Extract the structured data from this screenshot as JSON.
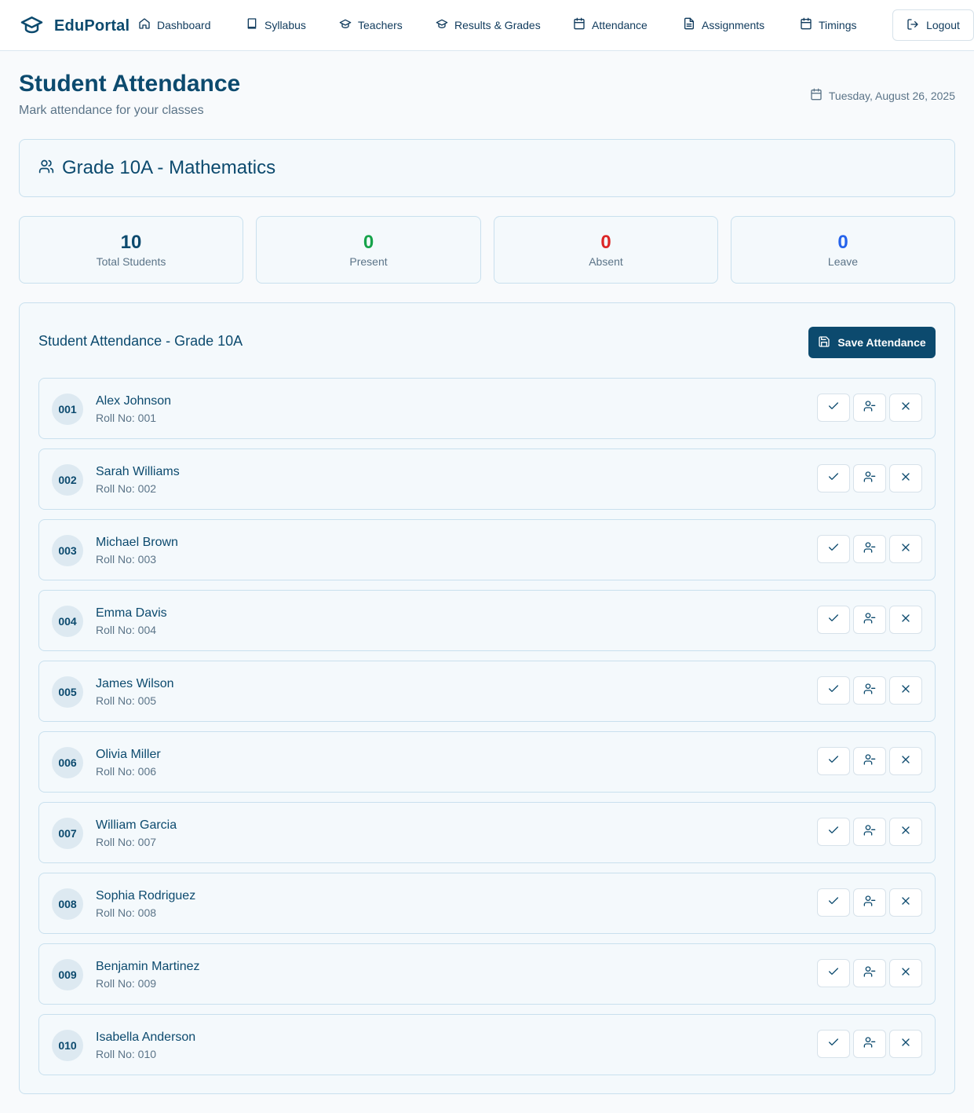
{
  "app": {
    "name": "EduPortal"
  },
  "nav": {
    "items": [
      {
        "label": "Dashboard",
        "icon": "home-icon"
      },
      {
        "label": "Syllabus",
        "icon": "book-icon"
      },
      {
        "label": "Teachers",
        "icon": "graduation-cap-icon"
      },
      {
        "label": "Results & Grades",
        "icon": "graduation-cap-icon"
      },
      {
        "label": "Attendance",
        "icon": "calendar-icon"
      },
      {
        "label": "Assignments",
        "icon": "document-icon"
      },
      {
        "label": "Timings",
        "icon": "calendar-icon"
      }
    ],
    "logout_label": "Logout"
  },
  "header": {
    "title": "Student Attendance",
    "subtitle": "Mark attendance for your classes",
    "date": "Tuesday, August 26, 2025"
  },
  "class_card": {
    "title": "Grade 10A - Mathematics"
  },
  "stats": [
    {
      "value": "10",
      "label": "Total Students",
      "color": "#0c4a6e"
    },
    {
      "value": "0",
      "label": "Present",
      "color": "#16a34a"
    },
    {
      "value": "0",
      "label": "Absent",
      "color": "#dc2626"
    },
    {
      "value": "0",
      "label": "Leave",
      "color": "#2563eb"
    }
  ],
  "panel": {
    "title": "Student Attendance - Grade 10A",
    "save_label": "Save Attendance"
  },
  "students": [
    {
      "badge": "001",
      "name": "Alex Johnson",
      "roll": "Roll No: 001"
    },
    {
      "badge": "002",
      "name": "Sarah Williams",
      "roll": "Roll No: 002"
    },
    {
      "badge": "003",
      "name": "Michael Brown",
      "roll": "Roll No: 003"
    },
    {
      "badge": "004",
      "name": "Emma Davis",
      "roll": "Roll No: 004"
    },
    {
      "badge": "005",
      "name": "James Wilson",
      "roll": "Roll No: 005"
    },
    {
      "badge": "006",
      "name": "Olivia Miller",
      "roll": "Roll No: 006"
    },
    {
      "badge": "007",
      "name": "William Garcia",
      "roll": "Roll No: 007"
    },
    {
      "badge": "008",
      "name": "Sophia Rodriguez",
      "roll": "Roll No: 008"
    },
    {
      "badge": "009",
      "name": "Benjamin Martinez",
      "roll": "Roll No: 009"
    },
    {
      "badge": "010",
      "name": "Isabella Anderson",
      "roll": "Roll No: 010"
    }
  ],
  "colors": {
    "primary": "#0c4a6e",
    "present": "#16a34a",
    "absent": "#dc2626",
    "leave": "#2563eb",
    "border": "#c9e0ee"
  }
}
